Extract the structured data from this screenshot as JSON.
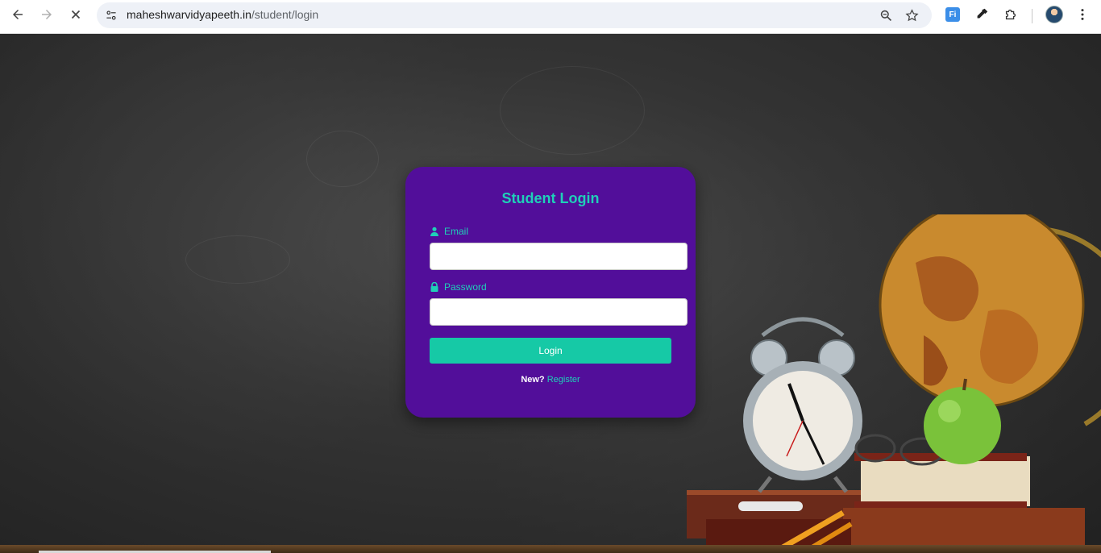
{
  "browser": {
    "url_domain": "maheshwarvidyapeeth.in",
    "url_path": "/student/login",
    "icons": [
      "back-arrow-icon",
      "forward-arrow-icon",
      "stop-loading-icon",
      "site-settings-icon",
      "zoom-icon",
      "bookmark-star-icon",
      "extension-fi-icon",
      "eyedropper-icon",
      "extensions-puzzle-icon",
      "profile-avatar",
      "kebab-menu-icon"
    ],
    "ext_fi_label": "Fi"
  },
  "login": {
    "title": "Student Login",
    "email_label": "Email",
    "email_value": "",
    "password_label": "Password",
    "password_value": "",
    "login_button": "Login",
    "new_text": "New?",
    "register_link": "Register"
  },
  "colors": {
    "card_bg": "#520e9a",
    "accent": "#1fd0b8",
    "button": "#16c9a6"
  }
}
